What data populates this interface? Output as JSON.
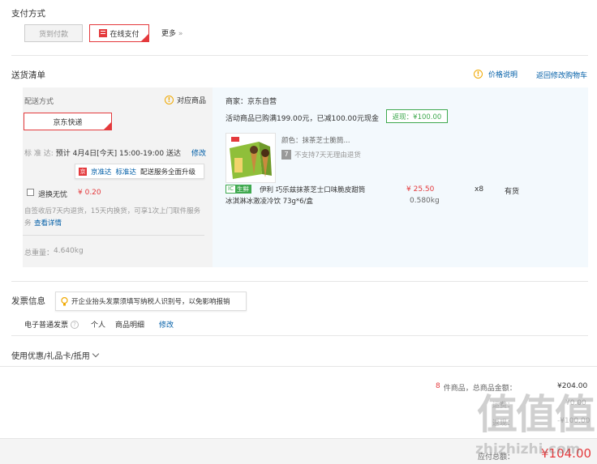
{
  "payment": {
    "title": "支付方式",
    "cod_label": "货到付款",
    "online_label": "在线支付",
    "more_label": "更多",
    "more_icon": "»"
  },
  "delivery_list": {
    "title": "送货清单",
    "price_note": "价格说明",
    "back_to_cart": "返回修改购物车",
    "shipping": {
      "label": "配送方式",
      "match_items": "对应商品",
      "method": "京东快递",
      "standard_label": "标 准 达:",
      "standard_time": "预计 4月4日[今天] 15:00-19:00 送达",
      "modify": "修改",
      "jd_badge": "京",
      "promo_a": "京准达",
      "promo_b": "标准达",
      "promo_c": "配送服务全面升级"
    },
    "returns": {
      "label": "退换无忧",
      "price": "¥ 0.20",
      "desc_line1": "自签收后7天内退货，15天内换货，可享1次上门取件服务",
      "details_link": "查看详情"
    },
    "total_weight_label": "总重量：",
    "total_weight": "4.640kg",
    "seller": "商家：京东自营",
    "promo_text": "活动商品已购满199.00元，已减100.00元现金",
    "rebate": "返现：¥100.00",
    "product": {
      "color_label": "颜色：抹茶芝士脆筒...",
      "no_return_badge": "7",
      "no_return_text": "不支持7天无理由退货",
      "fresh_tag_left": "IC",
      "fresh_tag_right": "生鲜",
      "name_line1": "伊利 巧乐兹抹茶芝士口味脆皮甜筒",
      "name_line2": "冰淇淋冰激凌冷饮 73g*6/盒",
      "price": "¥ 25.50",
      "weight": "0.580kg",
      "qty": "x8",
      "stock": "有货"
    }
  },
  "invoice": {
    "title": "发票信息",
    "tip": "开企业抬头发票须填写纳税人识别号，以免影响报销",
    "type": "电子普通发票",
    "holder": "个人",
    "content": "商品明细",
    "modify": "修改"
  },
  "coupon": {
    "label": "使用优惠/礼品卡/抵用"
  },
  "summary": {
    "count": "8",
    "count_suffix": "件商品，总商品金额：",
    "total": "¥204.00",
    "row2_label": "运费：",
    "row2_value": "¥0.00",
    "row3_label": "返现：",
    "row3_value": "-¥100.00",
    "payable_label": "应付总额：",
    "payable_value": "¥104.00"
  },
  "watermark": {
    "big": "值值值",
    "small": "zhizhizhi.com"
  },
  "colors": {
    "accent_red": "#e4393c",
    "link_blue": "#005ea7",
    "green": "#3fa94f",
    "warn": "#f0a800"
  }
}
